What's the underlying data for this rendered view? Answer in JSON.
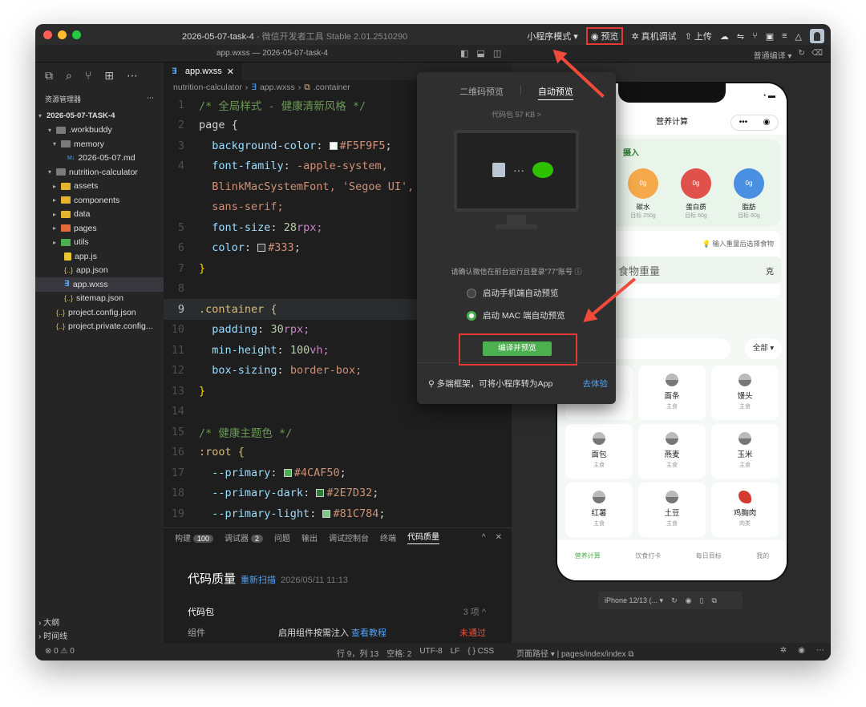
{
  "window": {
    "title": "2026-05-07-task-4",
    "title_suffix": " - 微信开发者工具 Stable 2.01.2510290",
    "subtitle": "app.wxss — 2026-05-07-task-4"
  },
  "toolbar": {
    "mode": "小程序模式 ▾",
    "preview": "预览",
    "device_debug": "真机调试",
    "upload": "上传",
    "compile_mode": "普通编译 ▾"
  },
  "sidebar": {
    "header": "资源管理器",
    "project": "2026-05-07-TASK-4",
    "items": [
      {
        "label": ".workbuddy"
      },
      {
        "label": "memory"
      },
      {
        "label": "2026-05-07.md"
      },
      {
        "label": "nutrition-calculator"
      },
      {
        "label": "assets"
      },
      {
        "label": "components"
      },
      {
        "label": "data"
      },
      {
        "label": "pages"
      },
      {
        "label": "utils"
      },
      {
        "label": "app.js"
      },
      {
        "label": "app.json"
      },
      {
        "label": "app.wxss"
      },
      {
        "label": "sitemap.json"
      },
      {
        "label": "project.config.json"
      },
      {
        "label": "project.private.config..."
      }
    ],
    "outline": "大纲",
    "timeline": "时间线"
  },
  "editor": {
    "tab": "app.wxss",
    "breadcrumb": [
      "nutrition-calculator",
      "app.wxss",
      ".container"
    ],
    "lines": [
      {
        "n": "1",
        "t": "/* 全局样式 - 健康清新风格 */"
      },
      {
        "n": "2",
        "t": "page {"
      },
      {
        "n": "3",
        "prop": "background-color",
        "val": "#F5F9F5"
      },
      {
        "n": "4",
        "prop": "font-family",
        "val": "-apple-system,"
      },
      {
        "n": "",
        "val": "BlinkMacSystemFont, 'Segoe UI', Ro"
      },
      {
        "n": "",
        "val": "sans-serif;"
      },
      {
        "n": "5",
        "prop": "font-size",
        "num": "28",
        "unit": "rpx;"
      },
      {
        "n": "6",
        "prop": "color",
        "val": "#333"
      },
      {
        "n": "7",
        "t": "}"
      },
      {
        "n": "8",
        "t": ""
      },
      {
        "n": "9",
        "t": ".container {"
      },
      {
        "n": "10",
        "prop": "padding",
        "num": "30",
        "unit": "rpx;"
      },
      {
        "n": "11",
        "prop": "min-height",
        "num": "100",
        "unit": "vh;"
      },
      {
        "n": "12",
        "prop": "box-sizing",
        "val": "border-box;"
      },
      {
        "n": "13",
        "t": "}"
      },
      {
        "n": "14",
        "t": ""
      },
      {
        "n": "15",
        "t": "/* 健康主题色 */"
      },
      {
        "n": "16",
        "t": ":root {"
      },
      {
        "n": "17",
        "prop": "--primary",
        "val": "#4CAF50"
      },
      {
        "n": "18",
        "prop": "--primary-dark",
        "val": "#2E7D32"
      },
      {
        "n": "19",
        "prop": "--primary-light",
        "val": "#81C784"
      }
    ]
  },
  "panel": {
    "tabs": [
      "构建",
      "调试器",
      "问题",
      "输出",
      "调试控制台",
      "终端",
      "代码质量"
    ],
    "build_count": "100",
    "debug_count": "2",
    "title": "代码质量",
    "rescan": "重新扫描",
    "time": "2026/05/11 11:13",
    "section": "代码包",
    "section_count": "3 项 ^",
    "row_label": "组件",
    "row_desc": "启用组件按需注入",
    "row_link": "查看教程",
    "row_status": "未通过"
  },
  "status": {
    "errors": "⊗ 0 ⚠ 0",
    "position": "行 9，列 13",
    "spaces": "空格: 2",
    "encoding": "UTF-8",
    "eol": "LF",
    "lang": "{ } CSS",
    "path_label": "页面路径 ▾",
    "path": "pages/index/index"
  },
  "popover": {
    "tab_qr": "二维码预览",
    "tab_auto": "自动预览",
    "size": "代码包 57 KB >",
    "note": "请确认微信在前台运行且登录\"77\"账号 ⓘ",
    "opt1": "启动手机端自动预览",
    "opt2": "启动 MAC 端自动预览",
    "compile": "编译并预览",
    "footer": "多端框架，可将小程序转为App",
    "footer_link": "去体验"
  },
  "phone": {
    "nav_title": "营养计算",
    "intake_label": "摄入",
    "macros": [
      {
        "value": "0g",
        "name": "碳水",
        "target": "目标 250g",
        "color": "#f6a94a"
      },
      {
        "value": "0g",
        "name": "蛋白质",
        "target": "目标 60g",
        "color": "#e0514b"
      },
      {
        "value": "0g",
        "name": "脂肪",
        "target": "目标 60g",
        "color": "#4a90e2"
      }
    ],
    "hint": "💡 输入重量后选择食物",
    "weight_placeholder": "食物重量",
    "weight_unit": "克",
    "filter_all": "全部 ▾",
    "foods": [
      {
        "name": "",
        "cat": ""
      },
      {
        "name": "面条",
        "cat": "主食"
      },
      {
        "name": "馒头",
        "cat": "主食"
      },
      {
        "name": "面包",
        "cat": "主食"
      },
      {
        "name": "燕麦",
        "cat": "主食"
      },
      {
        "name": "玉米",
        "cat": "主食"
      },
      {
        "name": "红薯",
        "cat": "主食"
      },
      {
        "name": "土豆",
        "cat": "主食"
      },
      {
        "name": "鸡胸肉",
        "cat": "肉类"
      }
    ],
    "tabs": [
      "营养计算",
      "饮食打卡",
      "每日目标",
      "我的"
    ],
    "device": "iPhone 12/13 (... ▾"
  }
}
